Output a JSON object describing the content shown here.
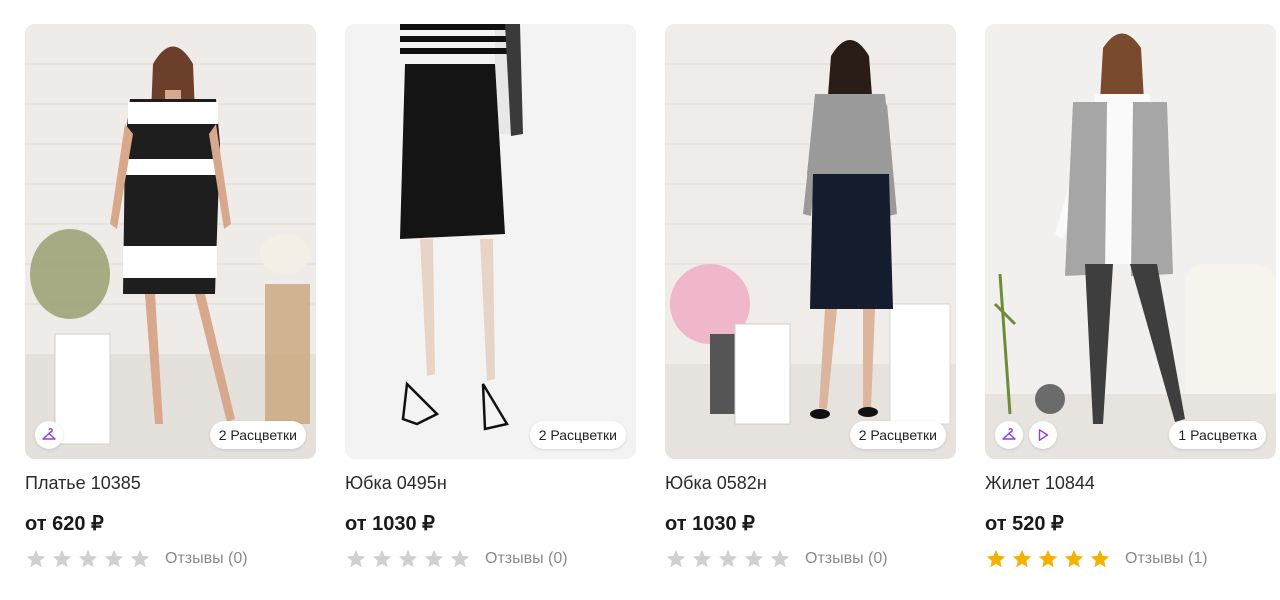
{
  "colors": {
    "accent": "#8b3ff0",
    "star_filled": "#f5b100",
    "star_empty": "#d0d0d0"
  },
  "products": [
    {
      "title": "Платье 10385",
      "price": "от 620 ₽",
      "colors_badge": "2 Расцветки",
      "rating": 0,
      "reviews": "Отзывы (0)",
      "icons": [
        "hanger-icon"
      ]
    },
    {
      "title": "Юбка 0495н",
      "price": "от 1030 ₽",
      "colors_badge": "2 Расцветки",
      "rating": 0,
      "reviews": "Отзывы (0)",
      "icons": []
    },
    {
      "title": "Юбка 0582н",
      "price": "от 1030 ₽",
      "colors_badge": "2 Расцветки",
      "rating": 0,
      "reviews": "Отзывы (0)",
      "icons": []
    },
    {
      "title": "Жилет 10844",
      "price": "от 520 ₽",
      "colors_badge": "1 Расцветка",
      "rating": 5,
      "reviews": "Отзывы (1)",
      "icons": [
        "hanger-icon",
        "play-icon"
      ]
    }
  ]
}
